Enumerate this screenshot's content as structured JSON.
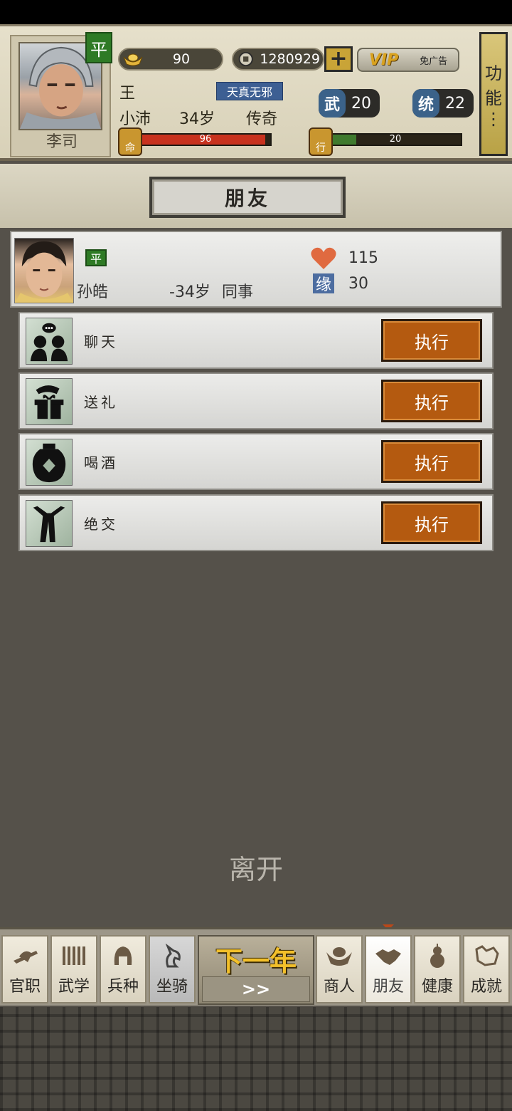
{
  "player": {
    "name": "李司",
    "badge": "平",
    "surname": "王",
    "place": "小沛",
    "age": "34岁",
    "title": "传奇",
    "trait": "天真无邪",
    "gold": "90",
    "coins": "1280929",
    "vip_label": "VIP",
    "vip_sub": "免广告",
    "wu_label": "武",
    "wu_value": "20",
    "tong_label": "统",
    "tong_value": "22",
    "life_icon_label": "命",
    "life_value": "96",
    "life_fraction": 0.96,
    "action_icon_label": "行",
    "action_value": "20",
    "action_fraction": 0.2,
    "func_label_1": "功",
    "func_label_2": "能",
    "func_more": "⋮"
  },
  "page": {
    "title": "朋友"
  },
  "friend": {
    "badge": "平",
    "name": "孙皓",
    "age": "-34岁",
    "relation": "同事",
    "affection": "115",
    "fate_label": "缘",
    "fate": "30"
  },
  "actions": [
    {
      "label": "聊天",
      "button": "执行",
      "icon": "chat-icon"
    },
    {
      "label": "送礼",
      "button": "执行",
      "icon": "gift-icon"
    },
    {
      "label": "喝酒",
      "button": "执行",
      "icon": "wine-jar-icon"
    },
    {
      "label": "绝交",
      "button": "执行",
      "icon": "break-icon"
    }
  ],
  "leave_label": "离开",
  "nav": {
    "items": [
      {
        "label": "官职"
      },
      {
        "label": "武学"
      },
      {
        "label": "兵种"
      },
      {
        "label": "坐骑"
      },
      {
        "label": "商人"
      },
      {
        "label": "朋友"
      },
      {
        "label": "健康"
      },
      {
        "label": "成就"
      }
    ],
    "next_year": "下一年",
    "next_arrows": ">>"
  },
  "colors": {
    "execute_button": "#b45a10",
    "life_bar": "#c8321e",
    "action_bar": "#3f7a2e",
    "badge_green": "#2e7a25"
  }
}
